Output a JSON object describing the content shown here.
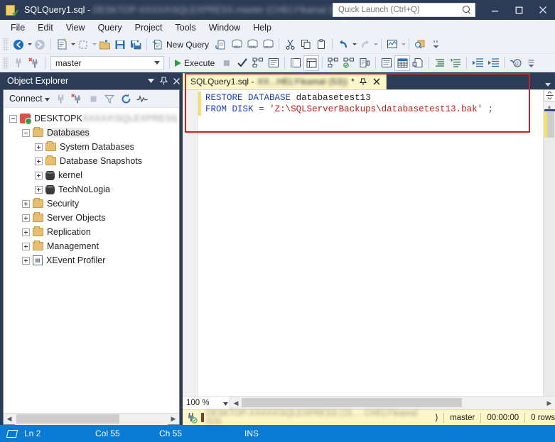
{
  "window": {
    "title_prefix": "SQLQuery1.sql - ",
    "title_blurred": "DESKTOP-XXXXX\\SQLEXPRESS.master (CHELY\\kamal (53))",
    "title_tail": "- ...",
    "app_icon": "sql-query-file-icon",
    "minimize": "minimize-icon",
    "maximize": "maximize-icon",
    "close": "close-icon"
  },
  "quick_launch": {
    "placeholder": "Quick Launch (Ctrl+Q)",
    "value": "",
    "icon": "search-icon"
  },
  "menu": {
    "items": [
      {
        "label": "File"
      },
      {
        "label": "Edit"
      },
      {
        "label": "View"
      },
      {
        "label": "Query"
      },
      {
        "label": "Project"
      },
      {
        "label": "Tools"
      },
      {
        "label": "Window"
      },
      {
        "label": "Help"
      }
    ]
  },
  "toolbar_top": {
    "back_icon": "navigate-back-icon",
    "forward_icon": "navigate-forward-icon",
    "new_query_with_current_connection_icon": "new-query-document-icon",
    "open_file_icon": "open-file-icon",
    "open_folder_icon": "open-folder-icon",
    "save_icon": "save-icon",
    "save_all_icon": "save-all-icon",
    "new_query_label": "New Query",
    "new_query_icon": "new-query-icon",
    "query_with_current_connection_icon": "query-connection-icon",
    "analysis_services_mdx_icon": "mdx-query-icon",
    "analysis_services_dmx_icon": "dmx-query-icon",
    "analysis_services_xmla_icon": "xmla-query-icon",
    "cut_icon": "cut-icon",
    "copy_icon": "copy-icon",
    "paste_icon": "paste-icon",
    "undo_icon": "undo-icon",
    "redo_icon": "redo-icon",
    "activity_monitor_icon": "activity-monitor-icon",
    "find_icon": "find-in-files-icon",
    "overflow_icon": "toolbar-overflow-icon"
  },
  "toolbar_query": {
    "connect_icon": "connect-icon",
    "disconnect_icon": "disconnect-icon",
    "database_value": "master",
    "database_dropdown_icon": "chevron-down-icon",
    "execute_label": "Execute",
    "execute_icon": "execute-play-icon",
    "stop_icon": "stop-icon",
    "parse_icon": "parse-check-icon",
    "display_estimated_plan_icon": "estimated-plan-icon",
    "query_options_icon": "query-options-icon",
    "include_actual_plan_icon": "actual-execution-plan-icon",
    "include_client_statistics_icon": "client-statistics-icon",
    "results_to_text_icon": "results-to-text-icon",
    "results_to_grid_icon": "results-to-grid-icon",
    "results_to_file_icon": "results-to-file-icon",
    "comment_icon": "comment-lines-icon",
    "uncomment_icon": "uncomment-lines-icon",
    "decrease_indent_icon": "decrease-indent-icon",
    "increase_indent_icon": "increase-indent-icon",
    "specify_values_icon": "specify-values-icon",
    "overflow_icon": "toolbar-overflow-icon"
  },
  "object_explorer": {
    "title": "Object Explorer",
    "dropdown_icon": "chevron-down-icon",
    "pin_icon": "pin-icon",
    "close_icon": "close-icon",
    "connect_label": "Connect",
    "connect_caret_icon": "chevron-down-icon",
    "connect_object_explorer_icon": "connect-plug-icon",
    "disconnect_icon": "disconnect-plug-icon",
    "stop_icon": "stop-icon",
    "filter_icon": "filter-funnel-icon",
    "refresh_icon": "refresh-icon",
    "activity_monitor_icon": "activity-monitor-icon",
    "tree": {
      "server_label": "DESKTOPK",
      "server_label_blurred": "XXXXX\\SQLEXPRESS (SQL Server",
      "server_icon": "server-icon",
      "nodes": [
        {
          "label": "Databases",
          "icon": "folder-icon",
          "level": 1,
          "expanded": true,
          "selected": true
        },
        {
          "label": "System Databases",
          "icon": "folder-icon",
          "level": 2,
          "expanded": false
        },
        {
          "label": "Database Snapshots",
          "icon": "folder-icon",
          "level": 2,
          "expanded": false
        },
        {
          "label": "kernel",
          "icon": "database-icon",
          "level": 2,
          "expanded": false
        },
        {
          "label": "TechNoLogia",
          "icon": "database-icon",
          "level": 2,
          "expanded": false
        },
        {
          "label": "Security",
          "icon": "folder-icon",
          "level": 1,
          "expanded": false
        },
        {
          "label": "Server Objects",
          "icon": "folder-icon",
          "level": 1,
          "expanded": false
        },
        {
          "label": "Replication",
          "icon": "folder-icon",
          "level": 1,
          "expanded": false
        },
        {
          "label": "Management",
          "icon": "folder-icon",
          "level": 1,
          "expanded": false
        },
        {
          "label": "XEvent Profiler",
          "icon": "xevent-profiler-icon",
          "level": 1,
          "expanded": false
        }
      ]
    },
    "scroll_left_icon": "scroll-left-icon",
    "scroll_right_icon": "scroll-right-icon"
  },
  "editor": {
    "tab": {
      "name": "SQLQuery1.sql - ",
      "name_blurred": "XX...HELY\\kamal (53))",
      "dirty_marker": "*",
      "pin_icon": "pin-icon",
      "close_icon": "close-icon"
    },
    "tab_overflow_icon": "chevron-down-icon",
    "code": {
      "line1": {
        "kw1": "RESTORE",
        "kw2": "DATABASE",
        "name": "databasetest13"
      },
      "line2": {
        "kw1": "FROM",
        "kw2": "DISK",
        "eq": "=",
        "path": "'Z:\\SQLServerBackups\\databasetest13.bak'",
        "terminator": ";"
      }
    },
    "zoom_value": "100 %",
    "zoom_dropdown_icon": "chevron-down-icon",
    "split_icon": "split-editor-icon",
    "scroll_up_icon": "scroll-up-icon",
    "scroll_left_icon": "scroll-left-icon",
    "scroll_right_icon": "scroll-right-icon"
  },
  "query_status": {
    "connected_icon": "connected-plug-icon",
    "connection_blurred": "DESKTOP-XXXXX\\SQLEXPRESS (15....   CHELY\\kamal (53)",
    "connection_tail": ")",
    "database": "master",
    "elapsed": "00:00:00",
    "rows": "0 rows"
  },
  "status_bar": {
    "ready_icon": "insert-mode-icon",
    "line": "Ln 2",
    "column": "Col 55",
    "character": "Ch 55",
    "insert_mode": "INS"
  },
  "annotation": {
    "color": "#e01b1b",
    "shape": "rectangle-highlight"
  },
  "colors": {
    "chrome": "#2d3c56",
    "toolbar": "#eef1f8",
    "tab_active": "#fdf6c8",
    "status_bar": "#0a7bd4",
    "keyword": "#1b3fbd",
    "string": "#c21b17"
  }
}
